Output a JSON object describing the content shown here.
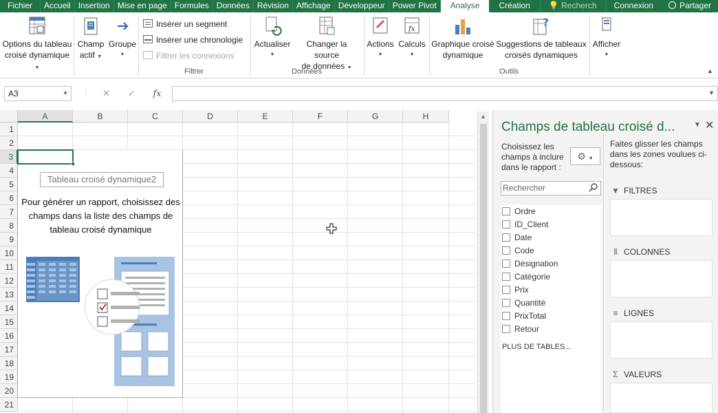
{
  "tabs": {
    "file": "Fichier",
    "home": "Accueil",
    "insert": "Insertion",
    "layout": "Mise en page",
    "formulas": "Formules",
    "data": "Données",
    "review": "Révision",
    "view": "Affichage",
    "developer": "Développeur",
    "powerpivot": "Power Pivot",
    "analyze": "Analyse",
    "design": "Création",
    "search": "Recherch",
    "login": "Connexion",
    "share": "Partager"
  },
  "ribbon": {
    "options_l1": "Options du tableau",
    "options_l2": "croisé dynamique",
    "field_l1": "Champ",
    "field_l2": "actif",
    "group": "Groupe",
    "insert_slicer": "Insérer un segment",
    "insert_timeline": "Insérer une chronologie",
    "filter_connections": "Filtrer les connexions",
    "group_filter": "Filtrer",
    "refresh": "Actualiser",
    "change_source_l1": "Changer la source",
    "change_source_l2": "de données",
    "group_data": "Données",
    "actions": "Actions",
    "calculations": "Calculs",
    "pivotchart_l1": "Graphique croisé",
    "pivotchart_l2": "dynamique",
    "suggestions_l1": "Suggestions de tableaux",
    "suggestions_l2": "croisés dynamiques",
    "group_tools": "Outils",
    "show": "Afficher"
  },
  "formula_bar": {
    "name_box": "A3",
    "cancel": "✕",
    "enter": "✓",
    "fx": "fx"
  },
  "grid": {
    "columns": [
      "A",
      "B",
      "C",
      "D",
      "E",
      "F",
      "G",
      "H"
    ],
    "rows": [
      "1",
      "2",
      "3",
      "4",
      "5",
      "6",
      "7",
      "8",
      "9",
      "10",
      "11",
      "12",
      "13",
      "14",
      "15",
      "16",
      "17",
      "18",
      "19",
      "20",
      "21"
    ]
  },
  "pivot_placeholder": {
    "name": "Tableau croisé dynamique2",
    "message": "Pour générer un rapport, choisissez des champs dans la liste des champs de tableau croisé dynamique"
  },
  "pane": {
    "title": "Champs de tableau croisé d...",
    "choose": "Choisissez les champs à inclure dans le rapport :",
    "search_placeholder": "Rechercher",
    "fields": [
      "Ordre",
      "ID_Client",
      "Date",
      "Code",
      "Désignation",
      "Catégorie",
      "Prix",
      "Quantité",
      "PrixTotal",
      "Retour"
    ],
    "more_tables": "PLUS DE TABLES...",
    "drag_hint": "Faites glisser les champs dans les zones voulues ci-dessous:",
    "zones": {
      "filters": "FILTRES",
      "columns": "COLONNES",
      "rows": "LIGNES",
      "values": "VALEURS"
    }
  },
  "colors": {
    "excel_green": "#217346",
    "ribbon_blue": "#4a7ebb",
    "illustration_blue": "#a9c4e3"
  }
}
